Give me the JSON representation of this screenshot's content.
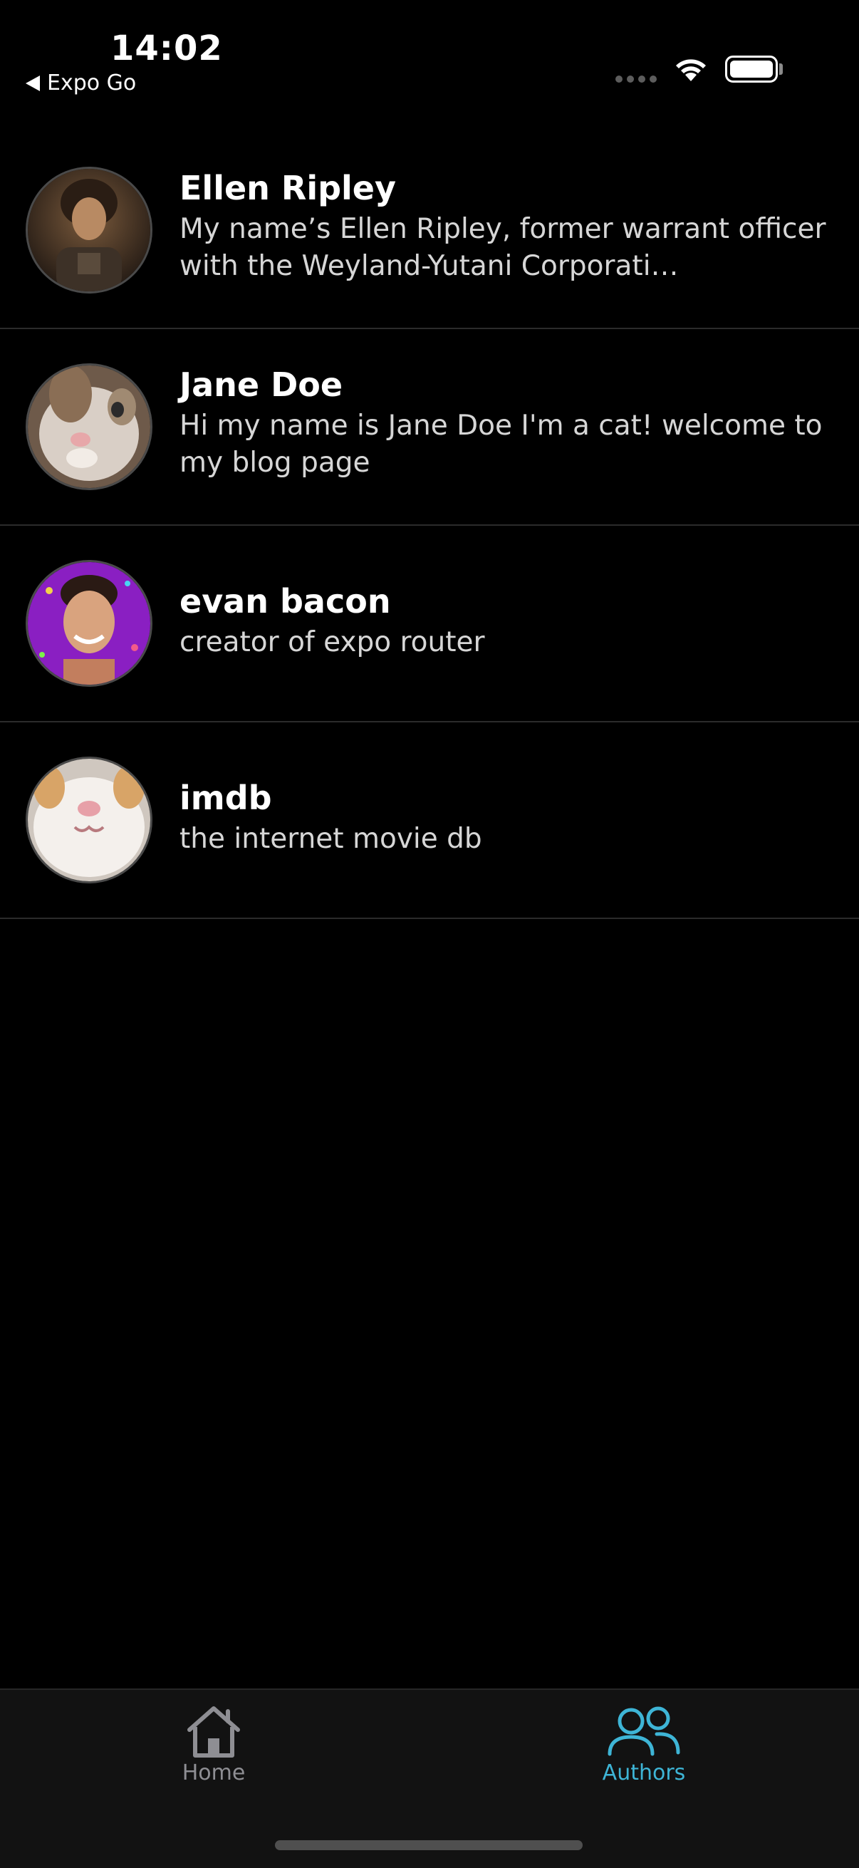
{
  "status_bar": {
    "time": "14:02",
    "back_label": "Expo Go"
  },
  "authors": [
    {
      "name": "Ellen Ripley",
      "bio": "My name’s Ellen Ripley, former warrant officer with the Weyland-Yutani Corporati…"
    },
    {
      "name": "Jane Doe",
      "bio": "Hi my name is Jane Doe I'm a cat! welcome to my blog page"
    },
    {
      "name": "evan bacon",
      "bio": "creator of expo router"
    },
    {
      "name": "imdb",
      "bio": "the internet movie db"
    }
  ],
  "tab_bar": {
    "tabs": [
      {
        "label": "Home",
        "icon": "home-icon",
        "active": false
      },
      {
        "label": "Authors",
        "icon": "people-icon",
        "active": true
      }
    ]
  },
  "colors": {
    "background": "#000000",
    "tab_bar_background": "#121212",
    "active_tab": "#3eb5d6",
    "inactive_tab": "#8e8e93",
    "divider": "#2b2b2b"
  }
}
